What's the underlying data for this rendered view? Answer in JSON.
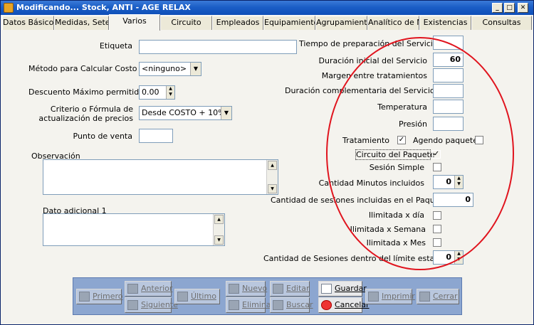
{
  "window": {
    "title": "Modificando... Stock, ANTI - AGE RELAX",
    "controls": {
      "minimize": "_",
      "maximize": "□",
      "close": "✕"
    }
  },
  "tabs": [
    {
      "label": "Datos Básicos"
    },
    {
      "label": "Medidas, Seteos"
    },
    {
      "label": "Varios"
    },
    {
      "label": "Circuito"
    },
    {
      "label": "Empleados"
    },
    {
      "label": "Equipamiento"
    },
    {
      "label": "Agrupamientos"
    },
    {
      "label": "Analítico de Mov"
    },
    {
      "label": "Existencias"
    },
    {
      "label": "Consultas"
    }
  ],
  "active_tab": "Varios",
  "left": {
    "etiqueta_label": "Etiqueta",
    "etiqueta_value": "",
    "metodo_label": "Método para Calcular Costo",
    "metodo_value": "<ninguno>",
    "descuento_label": "Descuento Máximo permitido",
    "descuento_value": "0.00",
    "criterio_label_1": "Criterio o Fórmula de",
    "criterio_label_2": "actualización de precios",
    "criterio_value": "Desde COSTO + 10%",
    "punto_label": "Punto de venta",
    "punto_value": "",
    "observacion_label": "Observación",
    "dato_label": "Dato adicional 1"
  },
  "right": {
    "tiempo_label": "Tiempo de preparación del Servicio",
    "tiempo_value": "",
    "duracion_label": "Duración inicial del Servicio",
    "duracion_value": "60",
    "margen_label": "Margen entre tratamientos",
    "margen_value": "",
    "duracion_comp_label": "Duración  complementaria  del Servicio",
    "duracion_comp_value": "",
    "temperatura_label": "Temperatura",
    "temperatura_value": "",
    "presion_label": "Presión",
    "presion_value": "",
    "tratamiento_label": "Tratamiento",
    "tratamiento_checked": true,
    "agendo_label": "Agendo paquete",
    "agendo_checked": false,
    "circuito_label": "Circuito del Paquete",
    "circuito_checked": true,
    "sesion_label": "Sesión Simple",
    "sesion_checked": false,
    "minutos_label": "Cantidad Minutos incluidos",
    "minutos_value": "0",
    "sesiones_pkg_label": "Cantidad de sesiones incluidas en el Paquete",
    "sesiones_pkg_value": "0",
    "ilim_dia_label": "Ilimitada x día",
    "ilim_semana_label": "Ilimitada x Semana",
    "ilim_mes_label": "Ilimitada x Mes",
    "sesiones_limite_label": "Cantidad de Sesiones  dentro del límite establecido",
    "sesiones_limite_value": "0"
  },
  "toolbar": {
    "primero": "Primero",
    "anterior": "Anterior",
    "siguiente": "Siguiente",
    "ultimo": "Último",
    "nuevo": "Nuevo",
    "eliminar": "Eliminar",
    "editar": "Editar",
    "buscar": "Buscar",
    "guardar": "Guardar",
    "cancelar": "Cancelar",
    "imprimir": "Imprimir",
    "cerrar": "Cerrar"
  },
  "colors": {
    "titlebar": "#1b5ec6",
    "annotation_circle": "#e0141e",
    "toolbar_bg": "#8ca6d0"
  }
}
